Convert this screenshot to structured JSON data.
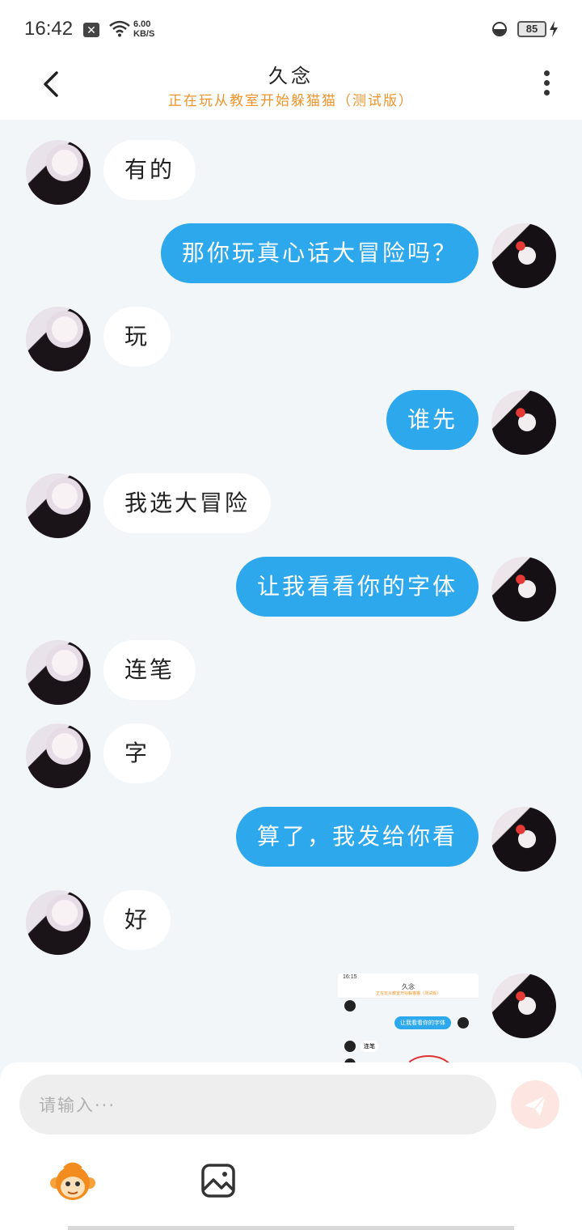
{
  "status_bar": {
    "time": "16:42",
    "net_speed_value": "6.00",
    "net_speed_unit": "KB/S",
    "battery": "85"
  },
  "header": {
    "title": "久念",
    "subtitle": "正在玩从教室开始躲猫猫（测试版）"
  },
  "messages": [
    {
      "side": "in",
      "text": "有的"
    },
    {
      "side": "out",
      "text": "那你玩真心话大冒险吗？"
    },
    {
      "side": "in",
      "text": "玩"
    },
    {
      "side": "out",
      "text": "谁先"
    },
    {
      "side": "in",
      "text": "我选大冒险"
    },
    {
      "side": "out",
      "text": "让我看看你的字体"
    },
    {
      "side": "in",
      "text": "连笔"
    },
    {
      "side": "in",
      "text": "字"
    },
    {
      "side": "out",
      "text": "算了，我发给你看"
    },
    {
      "side": "in",
      "text": "好"
    }
  ],
  "screenshot_thumbnail": {
    "status_time": "16:15",
    "title": "久念",
    "bubble_text": "让我看看你的字体",
    "reply_text": "连笔"
  },
  "composer": {
    "placeholder": "请输入···"
  },
  "icons": {
    "back": "back-arrow-icon",
    "more": "more-vertical-icon",
    "send": "send-plane-icon",
    "emoji": "monkey-emoji-icon",
    "image": "image-icon"
  },
  "colors": {
    "accent_blue": "#2ea8ec",
    "subtitle_orange": "#f0932b",
    "send_disabled": "#fde6e2",
    "chat_background": "#f3f6f8"
  }
}
